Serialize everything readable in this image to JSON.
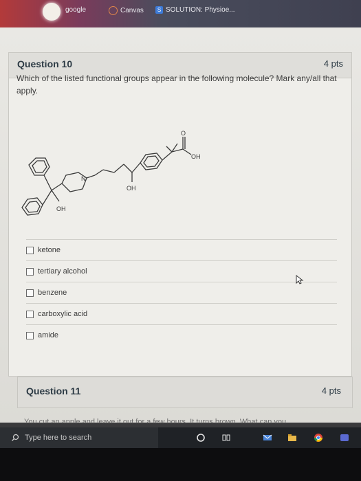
{
  "browser": {
    "bookmarks": [
      {
        "label": "google",
        "icon": "google-icon"
      },
      {
        "label": "Canvas",
        "icon": "canvas-icon"
      },
      {
        "label": "SOLUTION: Physioe...",
        "icon": "studysoup-icon",
        "icon_letter": "S"
      }
    ]
  },
  "question10": {
    "title": "Question 10",
    "points": "4 pts",
    "text": "Which of the listed functional groups appear in the following molecule? Mark any/all that apply.",
    "molecule_labels": {
      "n": "N",
      "oh1": "OH",
      "oh2": "OH",
      "oh3": "OH",
      "o": "O"
    },
    "answers": [
      "ketone",
      "tertiary alcohol",
      "benzene",
      "carboxylic acid",
      "amide"
    ]
  },
  "question11": {
    "title": "Question 11",
    "points": "4 pts",
    "peek_text": "You cut an apple and leave it out for a few hours. It turns brown. What can you"
  },
  "taskbar": {
    "search_placeholder": "Type here to search",
    "icons": [
      "search-icon",
      "cortana-icon",
      "task-view-icon",
      "mail-icon",
      "file-explorer-icon",
      "chrome-icon",
      "app-icon"
    ]
  },
  "colors": {
    "accent": "#2d3b45",
    "taskbar": "#1f2226"
  }
}
